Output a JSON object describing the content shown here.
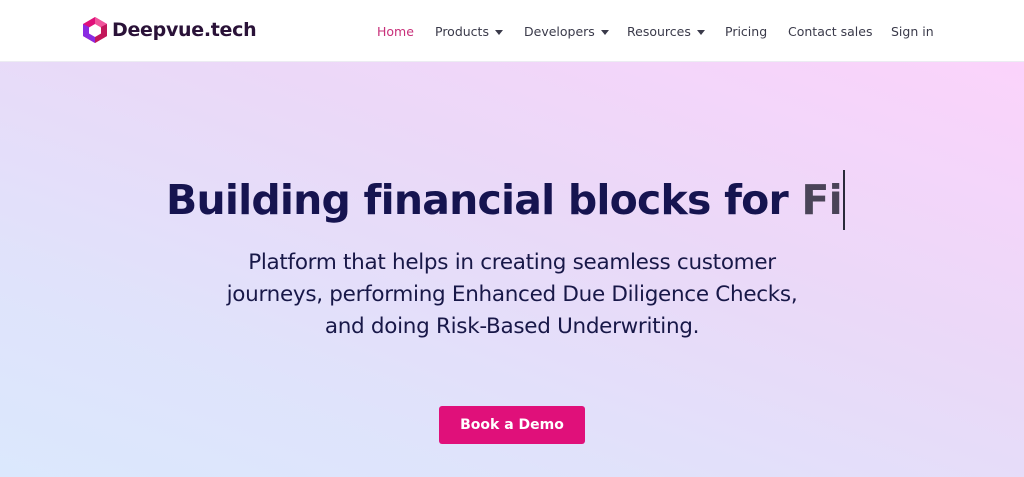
{
  "brand": {
    "name": "Deepvue.tech",
    "logo_colors": [
      "#e0107a",
      "#8a2be2",
      "#c2185b"
    ]
  },
  "nav": {
    "items": [
      {
        "label": "Home",
        "active": true,
        "has_dropdown": false
      },
      {
        "label": "Products",
        "active": false,
        "has_dropdown": true
      },
      {
        "label": "Developers",
        "active": false,
        "has_dropdown": true
      },
      {
        "label": "Resources",
        "active": false,
        "has_dropdown": true
      },
      {
        "label": "Pricing",
        "active": false,
        "has_dropdown": false
      },
      {
        "label": "Contact sales",
        "active": false,
        "has_dropdown": false
      },
      {
        "label": "Sign in",
        "active": false,
        "has_dropdown": false
      }
    ]
  },
  "hero": {
    "headline_static": "Building financial blocks for ",
    "headline_typed": "Fi",
    "subtext_lines": [
      "Platform that helps in creating seamless customer",
      "journeys, performing Enhanced Due Diligence Checks,",
      "and doing Risk-Based Underwriting."
    ],
    "cta_label": "Book a Demo"
  },
  "colors": {
    "accent": "#e0107a",
    "nav_active": "#c8307a",
    "headline": "#161450"
  }
}
